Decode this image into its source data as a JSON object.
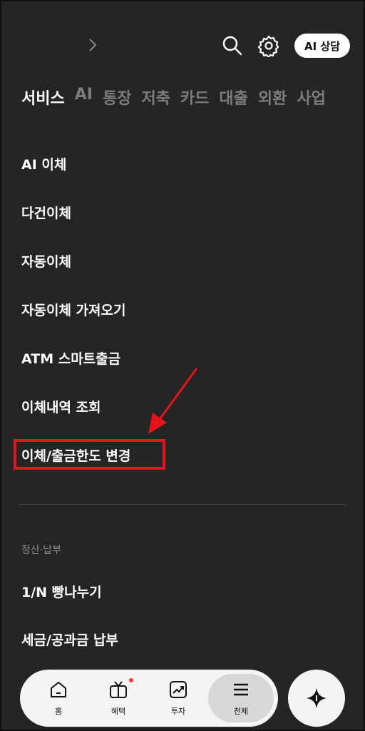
{
  "header": {
    "ai_button": "AI 상담"
  },
  "tabs": [
    "서비스",
    "AI",
    "통장",
    "저축",
    "카드",
    "대출",
    "외환",
    "사업"
  ],
  "menu": [
    "AI 이체",
    "다건이체",
    "자동이체",
    "자동이체 가져오기",
    "ATM 스마트출금",
    "이체내역 조회",
    "이체/출금한도 변경"
  ],
  "section": {
    "label": "정산·납부",
    "items": [
      "1/N 빵나누기",
      "세금/공과금 납부"
    ]
  },
  "bottom_nav": {
    "home": "홈",
    "benefit": "혜택",
    "invest": "투자",
    "all": "전체"
  },
  "colors": {
    "highlight": "#e4141b",
    "background": "#252525"
  }
}
